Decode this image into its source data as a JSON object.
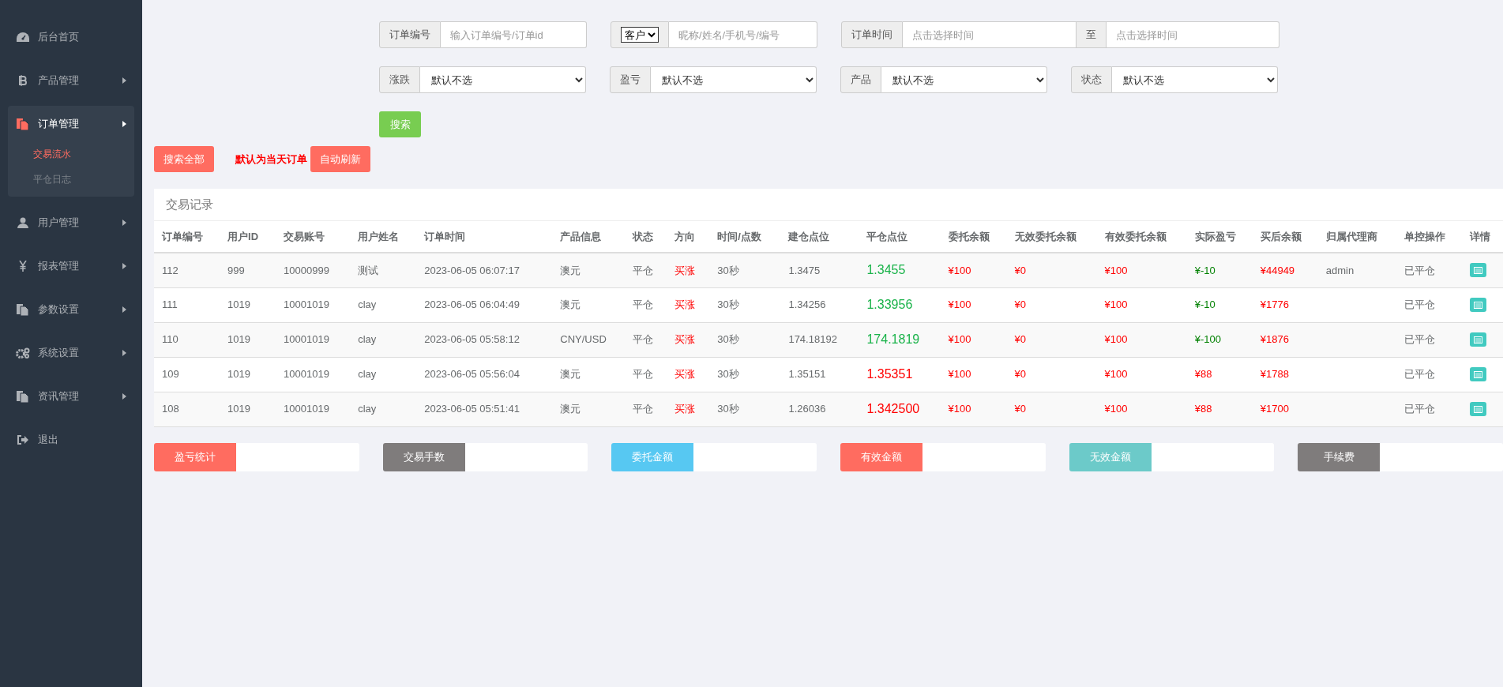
{
  "sidebar": {
    "items": [
      {
        "label": "后台首页",
        "kind": "link",
        "expanded": false
      },
      {
        "label": "产品管理",
        "kind": "menu",
        "expanded": false
      },
      {
        "label": "订单管理",
        "kind": "menu",
        "expanded": true,
        "children": [
          {
            "label": "交易流水",
            "selected": true
          },
          {
            "label": "平仓日志",
            "selected": false
          }
        ]
      },
      {
        "label": "用户管理",
        "kind": "menu",
        "expanded": false
      },
      {
        "label": "报表管理",
        "kind": "menu",
        "expanded": false
      },
      {
        "label": "参数设置",
        "kind": "menu",
        "expanded": false
      },
      {
        "label": "系统设置",
        "kind": "menu",
        "expanded": false
      },
      {
        "label": "资讯管理",
        "kind": "menu",
        "expanded": false
      },
      {
        "label": "退出",
        "kind": "link",
        "expanded": false
      }
    ]
  },
  "filters": {
    "order_no": {
      "label": "订单编号",
      "placeholder": "输入订单编号/订单id"
    },
    "customer": {
      "select_value": "客户",
      "placeholder": "昵称/姓名/手机号/编号"
    },
    "order_time": {
      "label": "订单时间",
      "placeholder": "点击选择时间",
      "separator": "至",
      "end_placeholder": "点击选择时间"
    },
    "selects": [
      {
        "label": "涨跌",
        "value": "默认不选"
      },
      {
        "label": "盈亏",
        "value": "默认不选"
      },
      {
        "label": "产品",
        "value": "默认不选"
      },
      {
        "label": "状态",
        "value": "默认不选"
      }
    ],
    "search_button": "搜索"
  },
  "actions": {
    "search_all": "搜索全部",
    "note": "默认为当天订单",
    "auto_refresh": "自动刷新"
  },
  "table": {
    "title": "交易记录",
    "columns": [
      "订单编号",
      "用户ID",
      "交易账号",
      "用户姓名",
      "订单时间",
      "产品信息",
      "状态",
      "方向",
      "时间/点数",
      "建仓点位",
      "平仓点位",
      "委托余额",
      "无效委托余额",
      "有效委托余额",
      "实际盈亏",
      "买后余额",
      "归属代理商",
      "单控操作",
      "详情"
    ],
    "rows": [
      {
        "order_no": "112",
        "user_id": "999",
        "account": "10000999",
        "name": "测试",
        "time": "2023-06-05 06:07:17",
        "product": "澳元",
        "status": "平仓",
        "direction": "买涨",
        "duration": "30秒",
        "open_price": "1.3475",
        "close_price": "1.3455",
        "profit": false,
        "entrust": "¥100",
        "invalid": "¥0",
        "valid": "¥100",
        "pnl": "¥-10",
        "balance": "¥44949",
        "agent": "admin",
        "control": "已平仓"
      },
      {
        "order_no": "111",
        "user_id": "1019",
        "account": "10001019",
        "name": "clay",
        "time": "2023-06-05 06:04:49",
        "product": "澳元",
        "status": "平仓",
        "direction": "买涨",
        "duration": "30秒",
        "open_price": "1.34256",
        "close_price": "1.33956",
        "profit": false,
        "entrust": "¥100",
        "invalid": "¥0",
        "valid": "¥100",
        "pnl": "¥-10",
        "balance": "¥1776",
        "control": "已平仓"
      },
      {
        "order_no": "110",
        "user_id": "1019",
        "account": "10001019",
        "name": "clay",
        "time": "2023-06-05 05:58:12",
        "product": "CNY/USD",
        "status": "平仓",
        "direction": "买涨",
        "duration": "30秒",
        "open_price": "174.18192",
        "close_price": "174.1819",
        "profit": false,
        "entrust": "¥100",
        "invalid": "¥0",
        "valid": "¥100",
        "pnl": "¥-100",
        "balance": "¥1876",
        "control": "已平仓"
      },
      {
        "order_no": "109",
        "user_id": "1019",
        "account": "10001019",
        "name": "clay",
        "time": "2023-06-05 05:56:04",
        "product": "澳元",
        "status": "平仓",
        "direction": "买涨",
        "duration": "30秒",
        "open_price": "1.35151",
        "close_price": "1.35351",
        "profit": true,
        "entrust": "¥100",
        "invalid": "¥0",
        "valid": "¥100",
        "pnl": "¥88",
        "balance": "¥1788",
        "control": "已平仓"
      },
      {
        "order_no": "108",
        "user_id": "1019",
        "account": "10001019",
        "name": "clay",
        "time": "2023-06-05 05:51:41",
        "product": "澳元",
        "status": "平仓",
        "direction": "买涨",
        "duration": "30秒",
        "open_price": "1.26036",
        "close_price": "1.342500",
        "profit": true,
        "entrust": "¥100",
        "invalid": "¥0",
        "valid": "¥100",
        "pnl": "¥88",
        "balance": "¥1700",
        "control": "已平仓"
      }
    ]
  },
  "stats": [
    {
      "label": "盈亏统计",
      "color": "#ff6c60"
    },
    {
      "label": "交易手数",
      "color": "#7f7c7c"
    },
    {
      "label": "委托金额",
      "color": "#57c8f2"
    },
    {
      "label": "有效金额",
      "color": "#ff6c60"
    },
    {
      "label": "无效金额",
      "color": "#6ccac9"
    },
    {
      "label": "手续费",
      "color": "#7f7c7c"
    }
  ]
}
